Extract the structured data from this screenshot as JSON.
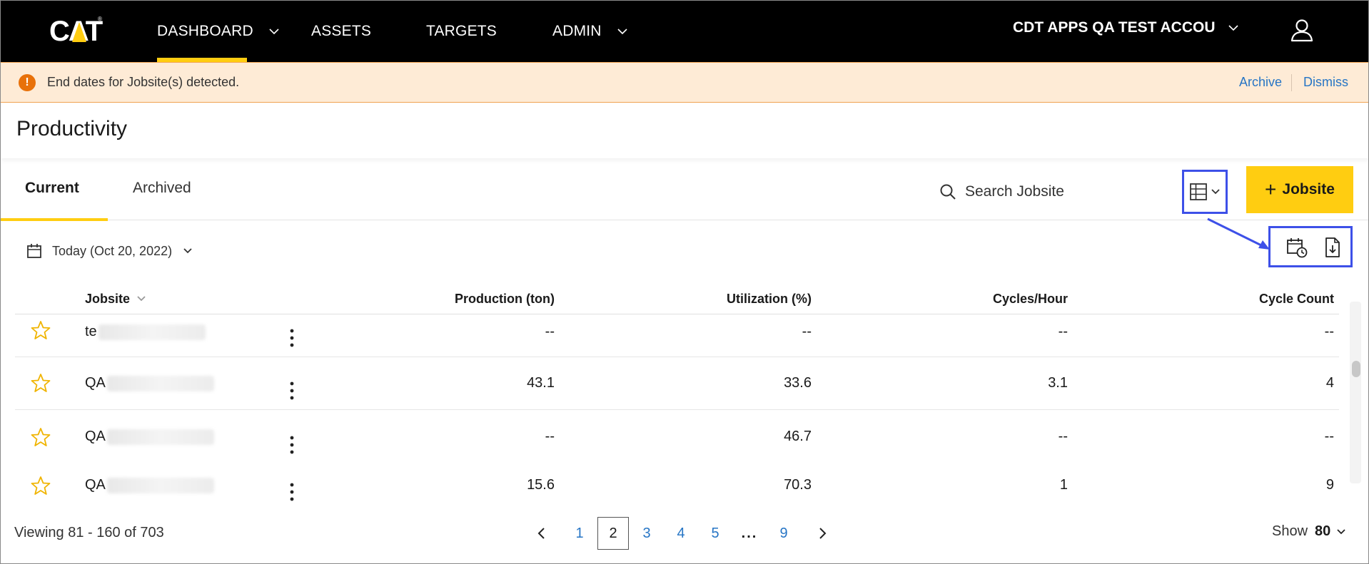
{
  "nav": {
    "logo_text": "CAT",
    "items": [
      {
        "label": "DASHBOARD",
        "active": true,
        "has_dropdown": true
      },
      {
        "label": "ASSETS",
        "active": false,
        "has_dropdown": false
      },
      {
        "label": "TARGETS",
        "active": false,
        "has_dropdown": false
      },
      {
        "label": "ADMIN",
        "active": false,
        "has_dropdown": true
      }
    ],
    "account": "CDT APPS QA TEST ACCOU"
  },
  "banner": {
    "message": "End dates for Jobsite(s) detected.",
    "archive_label": "Archive",
    "dismiss_label": "Dismiss"
  },
  "page": {
    "title": "Productivity"
  },
  "tabs": [
    {
      "label": "Current",
      "active": true
    },
    {
      "label": "Archived",
      "active": false
    }
  ],
  "search": {
    "placeholder": "Search Jobsite"
  },
  "add_button": {
    "label": "Jobsite"
  },
  "date_filter": {
    "label": "Today (Oct 20, 2022)"
  },
  "table": {
    "columns": [
      "Jobsite",
      "Production (ton)",
      "Utilization (%)",
      "Cycles/Hour",
      "Cycle Count"
    ],
    "rows": [
      {
        "name_prefix": "te",
        "production": "--",
        "utilization": "--",
        "cycles_hour": "--",
        "cycle_count": "--"
      },
      {
        "name_prefix": "QA",
        "production": "43.1",
        "utilization": "33.6",
        "cycles_hour": "3.1",
        "cycle_count": "4"
      },
      {
        "name_prefix": "QA",
        "production": "--",
        "utilization": "46.7",
        "cycles_hour": "--",
        "cycle_count": "--"
      },
      {
        "name_prefix": "QA",
        "production": "15.6",
        "utilization": "70.3",
        "cycles_hour": "1",
        "cycle_count": "9"
      }
    ]
  },
  "footer": {
    "viewing": "Viewing 81 - 160 of 703",
    "pages": [
      "1",
      "2",
      "3",
      "4",
      "5",
      "...",
      "9"
    ],
    "current_page": "2",
    "show_label": "Show",
    "show_value": "80"
  },
  "colors": {
    "accent": "#ffcd11",
    "link": "#2675c5",
    "warning": "#e8710a",
    "highlight": "#3d50e8"
  }
}
